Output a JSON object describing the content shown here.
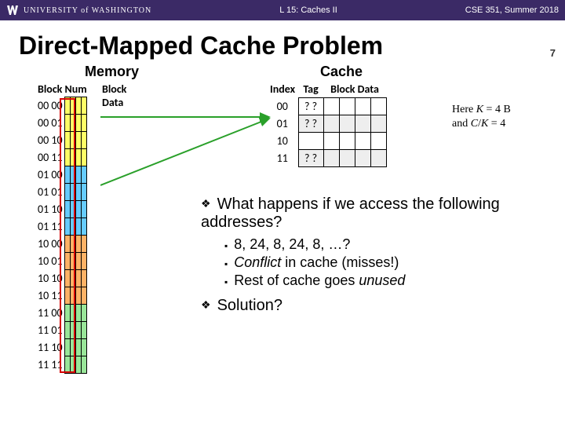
{
  "header": {
    "univ_small": "UNIVERSITY of WASHINGTON",
    "center": "L 15:  Caches II",
    "right": "CSE 351, Summer 2018"
  },
  "title": "Direct-Mapped Cache Problem",
  "memory": {
    "heading": "Memory",
    "col_blocknum": "Block Num",
    "col_blockdata": "Block Data",
    "rows": [
      "00 00",
      "00 01",
      "00 10",
      "00 11",
      "01 00",
      "01 01",
      "01 10",
      "01 11",
      "10 00",
      "10 01",
      "10 10",
      "10 11",
      "11 00",
      "11 01",
      "11 10",
      "11 11"
    ]
  },
  "cache": {
    "heading": "Cache",
    "col_index": "Index",
    "col_tag": "Tag",
    "col_blockdata": "Block Data",
    "rows": [
      {
        "idx": "00",
        "tag": "? ?"
      },
      {
        "idx": "01",
        "tag": "? ?"
      },
      {
        "idx": "10",
        "tag": ""
      },
      {
        "idx": "11",
        "tag": "? ?"
      }
    ]
  },
  "formula": {
    "l1a": "Here ",
    "l1b": "K",
    "l1c": " = 4 B",
    "l2a": "and ",
    "l2b": "C",
    "l2c": "/",
    "l2d": "K",
    "l2e": " = 4"
  },
  "bullets": {
    "q1": "What happens if we access the following addresses?",
    "s1": "8, 24, 8, 24, 8, …?",
    "s2a": "Conflict",
    "s2b": " in cache (misses!)",
    "s3a": "Rest of cache goes ",
    "s3b": "unused",
    "q2": "Solution?"
  },
  "page": "7"
}
